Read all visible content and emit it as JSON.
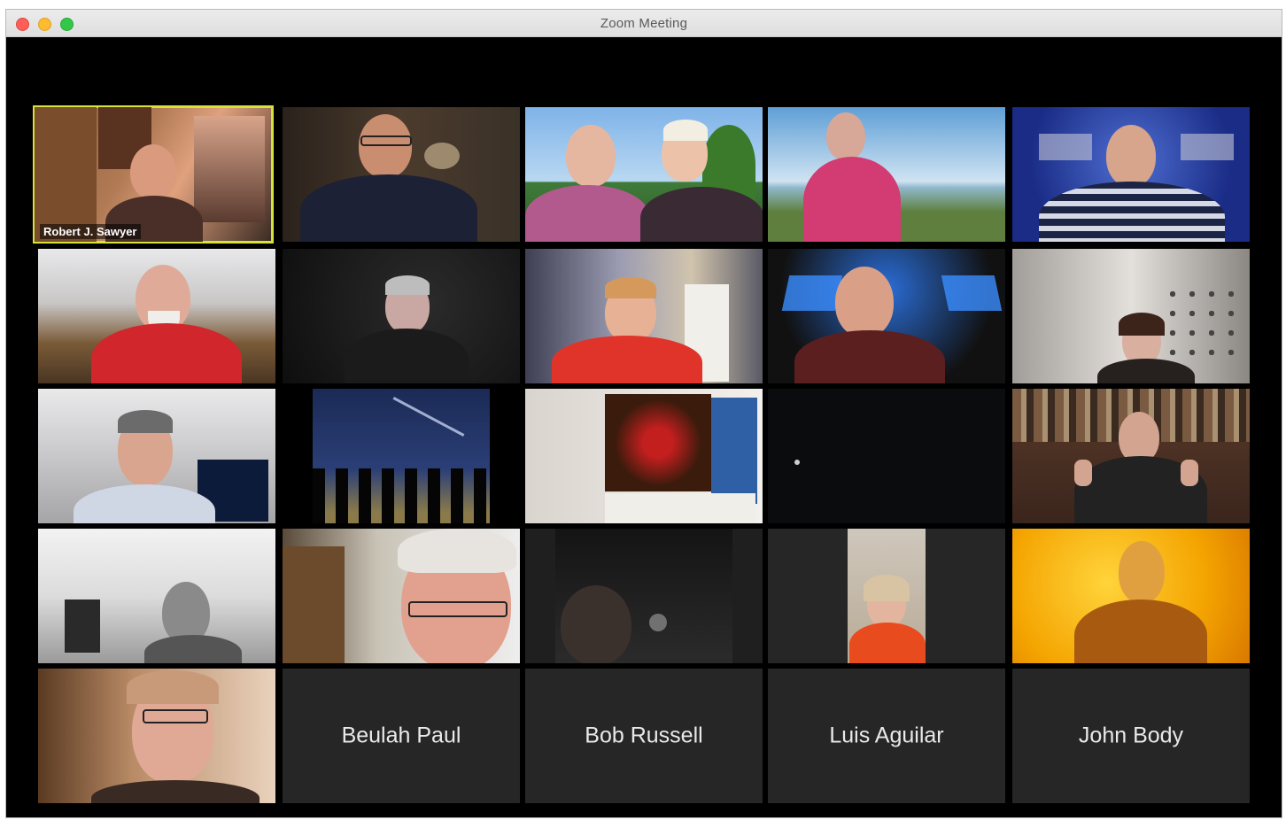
{
  "window": {
    "title": "Zoom Meeting"
  },
  "active_speaker": {
    "name": "Robert J. Sawyer"
  },
  "participants_no_video": [
    {
      "name": "Beulah Paul"
    },
    {
      "name": "Bob Russell"
    },
    {
      "name": "Luis Aguilar"
    },
    {
      "name": "John Body"
    }
  ],
  "colors": {
    "active_speaker_border": "#d5e23a",
    "background": "#000000",
    "tile_background": "#262626"
  }
}
